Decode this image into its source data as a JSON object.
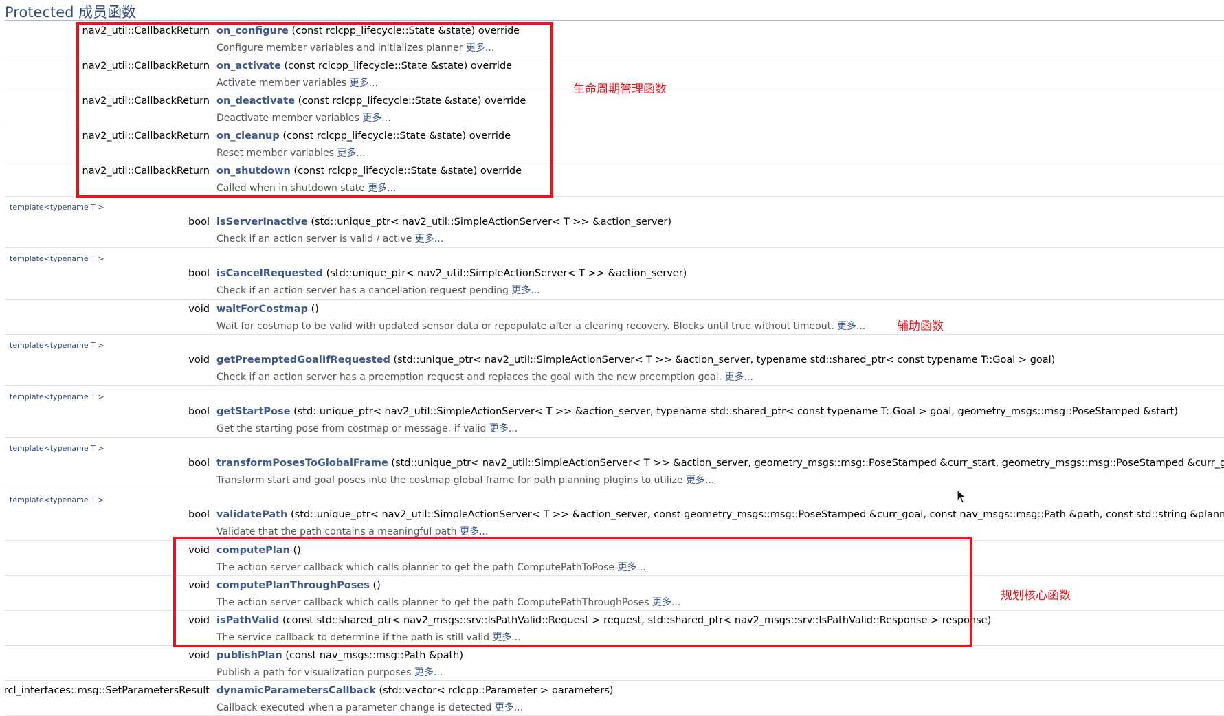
{
  "section": {
    "title": "Protected 成员函数"
  },
  "more_label": "更多...",
  "members": [
    {
      "template": "",
      "return_type": "nav2_util::CallbackReturn",
      "name": "on_configure",
      "params": "(const rclcpp_lifecycle::State &state) override",
      "brief": "Configure member variables and initializes planner "
    },
    {
      "template": "",
      "return_type": "nav2_util::CallbackReturn",
      "name": "on_activate",
      "params": "(const rclcpp_lifecycle::State &state) override",
      "brief": "Activate member variables "
    },
    {
      "template": "",
      "return_type": "nav2_util::CallbackReturn",
      "name": "on_deactivate",
      "params": "(const rclcpp_lifecycle::State &state) override",
      "brief": "Deactivate member variables "
    },
    {
      "template": "",
      "return_type": "nav2_util::CallbackReturn",
      "name": "on_cleanup",
      "params": "(const rclcpp_lifecycle::State &state) override",
      "brief": "Reset member variables "
    },
    {
      "template": "",
      "return_type": "nav2_util::CallbackReturn",
      "name": "on_shutdown",
      "params": "(const rclcpp_lifecycle::State &state) override",
      "brief": "Called when in shutdown state "
    },
    {
      "template": "template<typename T >",
      "return_type": "bool",
      "name": "isServerInactive",
      "params": "(std::unique_ptr< nav2_util::SimpleActionServer< T >> &action_server)",
      "brief": "Check if an action server is valid / active "
    },
    {
      "template": "template<typename T >",
      "return_type": "bool",
      "name": "isCancelRequested",
      "params": "(std::unique_ptr< nav2_util::SimpleActionServer< T >> &action_server)",
      "brief": "Check if an action server has a cancellation request pending "
    },
    {
      "template": "",
      "return_type": "void",
      "name": "waitForCostmap",
      "params": "()",
      "brief": "Wait for costmap to be valid with updated sensor data or repopulate after a clearing recovery. Blocks until true without timeout. "
    },
    {
      "template": "template<typename T >",
      "return_type": "void",
      "name": "getPreemptedGoalIfRequested",
      "params": "(std::unique_ptr< nav2_util::SimpleActionServer< T >> &action_server, typename std::shared_ptr< const typename T::Goal > goal)",
      "brief": "Check if an action server has a preemption request and replaces the goal with the new preemption goal. "
    },
    {
      "template": "template<typename T >",
      "return_type": "bool",
      "name": "getStartPose",
      "params": "(std::unique_ptr< nav2_util::SimpleActionServer< T >> &action_server, typename std::shared_ptr< const typename T::Goal > goal, geometry_msgs::msg::PoseStamped &start)",
      "brief": "Get the starting pose from costmap or message, if valid "
    },
    {
      "template": "template<typename T >",
      "return_type": "bool",
      "name": "transformPosesToGlobalFrame",
      "params": "(std::unique_ptr< nav2_util::SimpleActionServer< T >> &action_server, geometry_msgs::msg::PoseStamped &curr_start, geometry_msgs::msg::PoseStamped &curr_goal)",
      "brief": "Transform start and goal poses into the costmap global frame for path planning plugins to utilize "
    },
    {
      "template": "template<typename T >",
      "return_type": "bool",
      "name": "validatePath",
      "params": "(std::unique_ptr< nav2_util::SimpleActionServer< T >> &action_server, const geometry_msgs::msg::PoseStamped &curr_goal, const nav_msgs::msg::Path &path, const std::string &planner_id)",
      "brief": "Validate that the path contains a meaningful path "
    },
    {
      "template": "",
      "return_type": "void",
      "name": "computePlan",
      "params": "()",
      "brief": "The action server callback which calls planner to get the path ComputePathToPose "
    },
    {
      "template": "",
      "return_type": "void",
      "name": "computePlanThroughPoses",
      "params": "()",
      "brief": "The action server callback which calls planner to get the path ComputePathThroughPoses "
    },
    {
      "template": "",
      "return_type": "void",
      "name": "isPathValid",
      "params": "(const std::shared_ptr< nav2_msgs::srv::IsPathValid::Request > request, std::shared_ptr< nav2_msgs::srv::IsPathValid::Response > response)",
      "brief": "The service callback to determine if the path is still valid "
    },
    {
      "template": "",
      "return_type": "void",
      "name": "publishPlan",
      "params": "(const nav_msgs::msg::Path &path)",
      "brief": "Publish a path for visualization purposes "
    },
    {
      "template": "",
      "return_type": "rcl_interfaces::msg::SetParametersResult",
      "name": "dynamicParametersCallback",
      "params": "(std::vector< rclcpp::Parameter > parameters)",
      "brief": "Callback executed when a parameter change is detected "
    }
  ],
  "annotations": {
    "lifecycle_label": "生命周期管理函数",
    "helper_label": "辅助函数",
    "core_label": "规划核心函数",
    "box_color": "#E8141E"
  }
}
